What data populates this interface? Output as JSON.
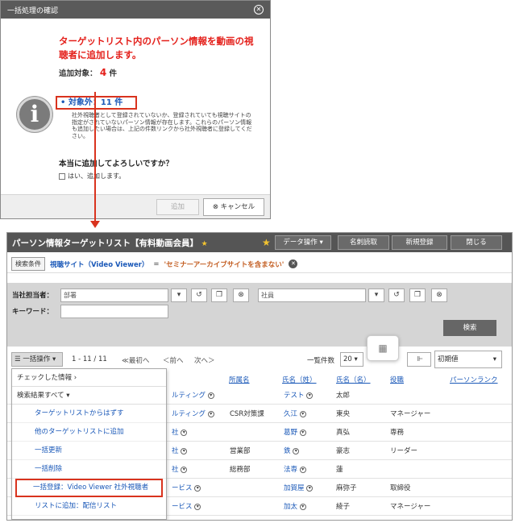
{
  "dialog": {
    "title": "一括処理の確認",
    "headline": "ターゲットリスト内のパーソン情報を動画の視聴者に追加します。",
    "add_target_label": "追加対象：",
    "add_target_count": "4",
    "add_target_unit": "件",
    "excluded_label": "• 対象外：11 件",
    "description": "社外視聴者として登録されていないか、登録されていても視聴サイトの指定がされていないパーソン情報が存在します。これらのパーソン情報も追加したい場合は、上記の件数リンクから社外視聴者に登録してください。",
    "question": "本当に追加してよろしいですか？",
    "confirm_label": "はい、追加します。",
    "add_button": "追加",
    "cancel_button": "キャンセル"
  },
  "panel": {
    "title": "パーソン情報ターゲットリスト【有料動画会員】",
    "data_ops": "データ操作",
    "card_read": "名刺読取",
    "new_register": "新規登録",
    "close": "閉じる",
    "search_cond_btn": "検索条件",
    "cond_label": "視聴サイト（Video Viewer）",
    "cond_op": "=",
    "cond_value": "'セミナーアーカイブサイトを含まない'",
    "owner_label": "当社担当者：",
    "dept_placeholder": "部署",
    "person_placeholder": "社員",
    "keyword_label": "キーワード：",
    "search_button": "検索",
    "bulk_ops": "一括操作",
    "pager": "1 - 11 / 11",
    "first": "≪最初へ",
    "prev": "＜前へ",
    "next": "次へ＞",
    "per_page_label": "一覧件数",
    "per_page": "20",
    "initial_value": "初期値"
  },
  "columns": [
    "所属名",
    "氏名（姓）",
    "氏名（名）",
    "役職",
    "パーソンランク"
  ],
  "rows": [
    {
      "company": "ルティング",
      "dept": "",
      "last": "テスト",
      "first": "太郎",
      "title": ""
    },
    {
      "company": "ルティング",
      "dept": "CSR対策課",
      "last": "久江",
      "first": "東央",
      "title": "マネージャー"
    },
    {
      "company": "社",
      "dept": "",
      "last": "葛野",
      "first": "真弘",
      "title": "専務"
    },
    {
      "company": "社",
      "dept": "営業部",
      "last": "鉄",
      "first": "豪志",
      "title": "リーダー"
    },
    {
      "company": "社",
      "dept": "総務部",
      "last": "法専",
      "first": "蓮",
      "title": ""
    },
    {
      "company": "ービス",
      "dept": "",
      "last": "加賀屋",
      "first": "麻弥子",
      "title": "取締役"
    },
    {
      "company": "ービス",
      "dept": "",
      "last": "加太",
      "first": "綾子",
      "title": "マネージャー"
    }
  ],
  "menu": {
    "checked_info": "チェックした情報",
    "all_results": "検索結果すべて",
    "items": [
      "ターゲットリストからはずす",
      "他のターゲットリストに追加",
      "一括更新",
      "一括削除",
      "一括登録：Video Viewer 社外視聴者",
      "リストに追加：配信リスト"
    ]
  },
  "colors": {
    "accent_red": "#d9331e",
    "link_blue": "#1a58b8",
    "header_gray": "#555555"
  }
}
